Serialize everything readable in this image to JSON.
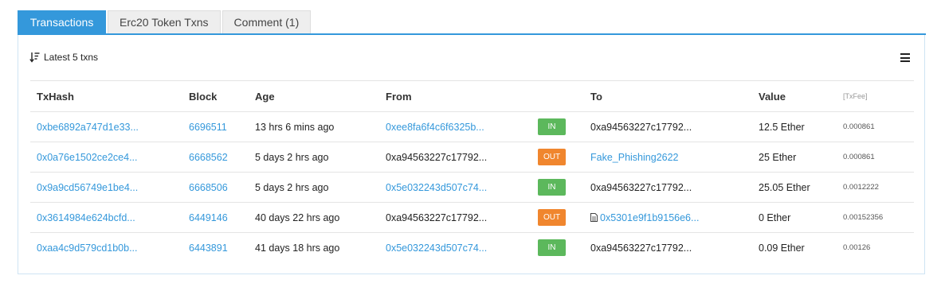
{
  "tabs": [
    {
      "label": "Transactions",
      "active": true
    },
    {
      "label": "Erc20 Token Txns",
      "active": false
    },
    {
      "label": "Comment (1)",
      "active": false
    }
  ],
  "toolbar": {
    "label": "Latest 5 txns",
    "sort_icon": "sort-descending-icon",
    "menu_icon": "hamburger-menu-icon"
  },
  "columns": {
    "txhash": "TxHash",
    "block": "Block",
    "age": "Age",
    "from": "From",
    "to": "To",
    "value": "Value",
    "fee": "[TxFee]"
  },
  "colors": {
    "accent": "#3498db",
    "in_badge": "#5cb85c",
    "out_badge": "#f0862e"
  },
  "rows": [
    {
      "hash": "0xbe6892a747d1e33...",
      "block": "6696511",
      "age": "13 hrs 6 mins ago",
      "from": "0xee8fa6f4c6f6325b...",
      "dir": "IN",
      "to": "0xa94563227c17792...",
      "value": "12.5 Ether",
      "fee": "0.000861"
    },
    {
      "hash": "0x0a76e1502ce2ce4...",
      "block": "6668562",
      "age": "5 days 2 hrs ago",
      "from": "0xa94563227c17792...",
      "dir": "OUT",
      "to": "Fake_Phishing2622",
      "value": "25 Ether",
      "fee": "0.000861"
    },
    {
      "hash": "0x9a9cd56749e1be4...",
      "block": "6668506",
      "age": "5 days 2 hrs ago",
      "from": "0x5e032243d507c74...",
      "dir": "IN",
      "to": "0xa94563227c17792...",
      "value": "25.05 Ether",
      "fee": "0.0012222"
    },
    {
      "hash": "0x3614984e624bcfd...",
      "block": "6449146",
      "age": "40 days 22 hrs ago",
      "from": "0xa94563227c17792...",
      "dir": "OUT",
      "to": "0x5301e9f1b9156e6...",
      "value": "0 Ether",
      "fee": "0.00152356"
    },
    {
      "hash": "0xaa4c9d579cd1b0b...",
      "block": "6443891",
      "age": "41 days 18 hrs ago",
      "from": "0x5e032243d507c74...",
      "dir": "IN",
      "to": "0xa94563227c17792...",
      "value": "0.09 Ether",
      "fee": "0.00126"
    }
  ]
}
